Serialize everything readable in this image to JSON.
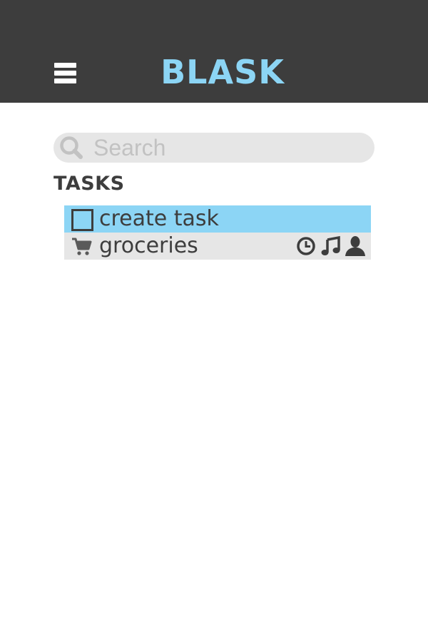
{
  "app": {
    "title": "BLASK",
    "menu_icon": "hamburger-menu-icon"
  },
  "search": {
    "placeholder": "Search",
    "value": "",
    "icon": "search-icon"
  },
  "tasks_section": {
    "title": "TASKS",
    "items": [
      {
        "label": "create task",
        "icon": "checkbox-icon",
        "selected": true
      },
      {
        "label": "groceries",
        "icon": "shopping-cart-icon",
        "selected": false,
        "meta_icons": [
          "clock-icon",
          "music-note-icon",
          "person-icon"
        ]
      }
    ]
  },
  "colors": {
    "header_bg": "#3d3d3d",
    "accent": "#8cd5f5",
    "row_bg": "#e6e6e6",
    "text_dark": "#3d3d3d",
    "placeholder": "#c2c2c2"
  }
}
